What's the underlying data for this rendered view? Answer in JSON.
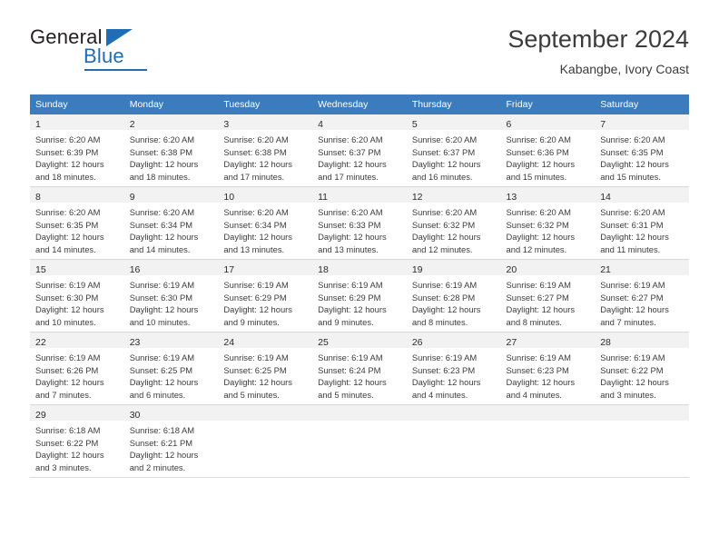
{
  "brand": {
    "name_part1": "General",
    "name_part2": "Blue",
    "accent_color": "#1f6eb5"
  },
  "header": {
    "title": "September 2024",
    "subtitle": "Kabangbe, Ivory Coast"
  },
  "theme": {
    "header_row_bg": "#3b7cbf",
    "daynum_bg": "#f2f2f2",
    "grid_line": "#d9d9d9",
    "text": "#3c3c3c"
  },
  "columns": [
    "Sunday",
    "Monday",
    "Tuesday",
    "Wednesday",
    "Thursday",
    "Friday",
    "Saturday"
  ],
  "weeks": [
    [
      {
        "day": "1",
        "sunrise": "Sunrise: 6:20 AM",
        "sunset": "Sunset: 6:39 PM",
        "daylight1": "Daylight: 12 hours",
        "daylight2": "and 18 minutes."
      },
      {
        "day": "2",
        "sunrise": "Sunrise: 6:20 AM",
        "sunset": "Sunset: 6:38 PM",
        "daylight1": "Daylight: 12 hours",
        "daylight2": "and 18 minutes."
      },
      {
        "day": "3",
        "sunrise": "Sunrise: 6:20 AM",
        "sunset": "Sunset: 6:38 PM",
        "daylight1": "Daylight: 12 hours",
        "daylight2": "and 17 minutes."
      },
      {
        "day": "4",
        "sunrise": "Sunrise: 6:20 AM",
        "sunset": "Sunset: 6:37 PM",
        "daylight1": "Daylight: 12 hours",
        "daylight2": "and 17 minutes."
      },
      {
        "day": "5",
        "sunrise": "Sunrise: 6:20 AM",
        "sunset": "Sunset: 6:37 PM",
        "daylight1": "Daylight: 12 hours",
        "daylight2": "and 16 minutes."
      },
      {
        "day": "6",
        "sunrise": "Sunrise: 6:20 AM",
        "sunset": "Sunset: 6:36 PM",
        "daylight1": "Daylight: 12 hours",
        "daylight2": "and 15 minutes."
      },
      {
        "day": "7",
        "sunrise": "Sunrise: 6:20 AM",
        "sunset": "Sunset: 6:35 PM",
        "daylight1": "Daylight: 12 hours",
        "daylight2": "and 15 minutes."
      }
    ],
    [
      {
        "day": "8",
        "sunrise": "Sunrise: 6:20 AM",
        "sunset": "Sunset: 6:35 PM",
        "daylight1": "Daylight: 12 hours",
        "daylight2": "and 14 minutes."
      },
      {
        "day": "9",
        "sunrise": "Sunrise: 6:20 AM",
        "sunset": "Sunset: 6:34 PM",
        "daylight1": "Daylight: 12 hours",
        "daylight2": "and 14 minutes."
      },
      {
        "day": "10",
        "sunrise": "Sunrise: 6:20 AM",
        "sunset": "Sunset: 6:34 PM",
        "daylight1": "Daylight: 12 hours",
        "daylight2": "and 13 minutes."
      },
      {
        "day": "11",
        "sunrise": "Sunrise: 6:20 AM",
        "sunset": "Sunset: 6:33 PM",
        "daylight1": "Daylight: 12 hours",
        "daylight2": "and 13 minutes."
      },
      {
        "day": "12",
        "sunrise": "Sunrise: 6:20 AM",
        "sunset": "Sunset: 6:32 PM",
        "daylight1": "Daylight: 12 hours",
        "daylight2": "and 12 minutes."
      },
      {
        "day": "13",
        "sunrise": "Sunrise: 6:20 AM",
        "sunset": "Sunset: 6:32 PM",
        "daylight1": "Daylight: 12 hours",
        "daylight2": "and 12 minutes."
      },
      {
        "day": "14",
        "sunrise": "Sunrise: 6:20 AM",
        "sunset": "Sunset: 6:31 PM",
        "daylight1": "Daylight: 12 hours",
        "daylight2": "and 11 minutes."
      }
    ],
    [
      {
        "day": "15",
        "sunrise": "Sunrise: 6:19 AM",
        "sunset": "Sunset: 6:30 PM",
        "daylight1": "Daylight: 12 hours",
        "daylight2": "and 10 minutes."
      },
      {
        "day": "16",
        "sunrise": "Sunrise: 6:19 AM",
        "sunset": "Sunset: 6:30 PM",
        "daylight1": "Daylight: 12 hours",
        "daylight2": "and 10 minutes."
      },
      {
        "day": "17",
        "sunrise": "Sunrise: 6:19 AM",
        "sunset": "Sunset: 6:29 PM",
        "daylight1": "Daylight: 12 hours",
        "daylight2": "and 9 minutes."
      },
      {
        "day": "18",
        "sunrise": "Sunrise: 6:19 AM",
        "sunset": "Sunset: 6:29 PM",
        "daylight1": "Daylight: 12 hours",
        "daylight2": "and 9 minutes."
      },
      {
        "day": "19",
        "sunrise": "Sunrise: 6:19 AM",
        "sunset": "Sunset: 6:28 PM",
        "daylight1": "Daylight: 12 hours",
        "daylight2": "and 8 minutes."
      },
      {
        "day": "20",
        "sunrise": "Sunrise: 6:19 AM",
        "sunset": "Sunset: 6:27 PM",
        "daylight1": "Daylight: 12 hours",
        "daylight2": "and 8 minutes."
      },
      {
        "day": "21",
        "sunrise": "Sunrise: 6:19 AM",
        "sunset": "Sunset: 6:27 PM",
        "daylight1": "Daylight: 12 hours",
        "daylight2": "and 7 minutes."
      }
    ],
    [
      {
        "day": "22",
        "sunrise": "Sunrise: 6:19 AM",
        "sunset": "Sunset: 6:26 PM",
        "daylight1": "Daylight: 12 hours",
        "daylight2": "and 7 minutes."
      },
      {
        "day": "23",
        "sunrise": "Sunrise: 6:19 AM",
        "sunset": "Sunset: 6:25 PM",
        "daylight1": "Daylight: 12 hours",
        "daylight2": "and 6 minutes."
      },
      {
        "day": "24",
        "sunrise": "Sunrise: 6:19 AM",
        "sunset": "Sunset: 6:25 PM",
        "daylight1": "Daylight: 12 hours",
        "daylight2": "and 5 minutes."
      },
      {
        "day": "25",
        "sunrise": "Sunrise: 6:19 AM",
        "sunset": "Sunset: 6:24 PM",
        "daylight1": "Daylight: 12 hours",
        "daylight2": "and 5 minutes."
      },
      {
        "day": "26",
        "sunrise": "Sunrise: 6:19 AM",
        "sunset": "Sunset: 6:23 PM",
        "daylight1": "Daylight: 12 hours",
        "daylight2": "and 4 minutes."
      },
      {
        "day": "27",
        "sunrise": "Sunrise: 6:19 AM",
        "sunset": "Sunset: 6:23 PM",
        "daylight1": "Daylight: 12 hours",
        "daylight2": "and 4 minutes."
      },
      {
        "day": "28",
        "sunrise": "Sunrise: 6:19 AM",
        "sunset": "Sunset: 6:22 PM",
        "daylight1": "Daylight: 12 hours",
        "daylight2": "and 3 minutes."
      }
    ],
    [
      {
        "day": "29",
        "sunrise": "Sunrise: 6:18 AM",
        "sunset": "Sunset: 6:22 PM",
        "daylight1": "Daylight: 12 hours",
        "daylight2": "and 3 minutes."
      },
      {
        "day": "30",
        "sunrise": "Sunrise: 6:18 AM",
        "sunset": "Sunset: 6:21 PM",
        "daylight1": "Daylight: 12 hours",
        "daylight2": "and 2 minutes."
      },
      {
        "day": "",
        "sunrise": "",
        "sunset": "",
        "daylight1": "",
        "daylight2": ""
      },
      {
        "day": "",
        "sunrise": "",
        "sunset": "",
        "daylight1": "",
        "daylight2": ""
      },
      {
        "day": "",
        "sunrise": "",
        "sunset": "",
        "daylight1": "",
        "daylight2": ""
      },
      {
        "day": "",
        "sunrise": "",
        "sunset": "",
        "daylight1": "",
        "daylight2": ""
      },
      {
        "day": "",
        "sunrise": "",
        "sunset": "",
        "daylight1": "",
        "daylight2": ""
      }
    ]
  ]
}
